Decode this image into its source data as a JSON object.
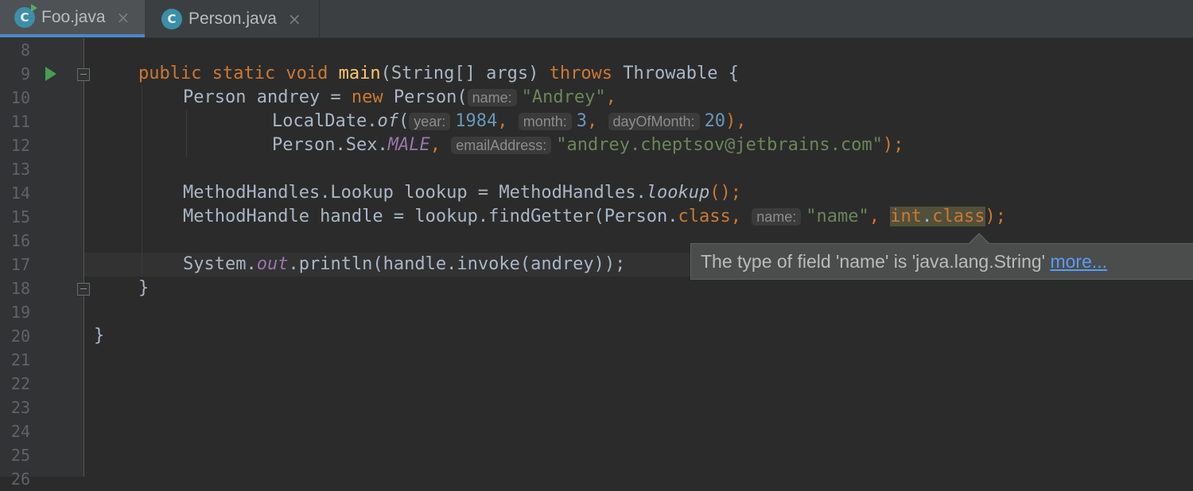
{
  "tabs": [
    {
      "label": "Foo.java",
      "icon": "java-class-icon",
      "active": true
    },
    {
      "label": "Person.java",
      "icon": "java-class-icon",
      "active": false
    }
  ],
  "tab_close_glyph": "×",
  "gutter": {
    "line_numbers": [
      "8",
      "9",
      "10",
      "11",
      "12",
      "13",
      "14",
      "15",
      "16",
      "17",
      "18",
      "19",
      "20",
      "21",
      "22",
      "23",
      "24",
      "25",
      "26"
    ]
  },
  "code": {
    "l9": {
      "kw1": "public static void ",
      "method": "main",
      "rest": "(String[] args) ",
      "throws": "throws",
      "end": " Throwable {"
    },
    "l10": {
      "a": "Person andrey = ",
      "new": "new",
      "b": " Person(",
      "hint": "name:",
      "str": "\"Andrey\"",
      "c": ","
    },
    "l11": {
      "a": "LocalDate.",
      "of": "of",
      "b": "(",
      "hint1": "year:",
      "n1": "1984",
      "c1": ", ",
      "hint2": "month:",
      "n2": "3",
      "c2": ", ",
      "hint3": "dayOfMonth:",
      "n3": "20",
      "c3": "),"
    },
    "l12": {
      "a": "Person.Sex.",
      "male": "MALE",
      "c1": ", ",
      "hint": "emailAddress:",
      "str": "\"andrey.cheptsov@jetbrains.com\"",
      "end": ");"
    },
    "l14": {
      "a": "MethodHandles.Lookup lookup = MethodHandles.",
      "lookup": "lookup",
      "end": "();"
    },
    "l15": {
      "a": "MethodHandle handle = lookup.findGetter(Person.",
      "cls": "class",
      "c1": ", ",
      "hint": "name:",
      "str": "\"name\"",
      "c2": ", ",
      "int": "int",
      "dot": ".",
      "cls2": "class",
      "end": ");"
    },
    "l17": {
      "a": "System.",
      "out": "out",
      "b": ".println(handle.invoke(andrey));"
    },
    "l18": {
      "a": "}"
    },
    "l20": {
      "a": "}"
    }
  },
  "tooltip": {
    "text": "The type of field 'name' is 'java.lang.String' ",
    "link": "more..."
  }
}
